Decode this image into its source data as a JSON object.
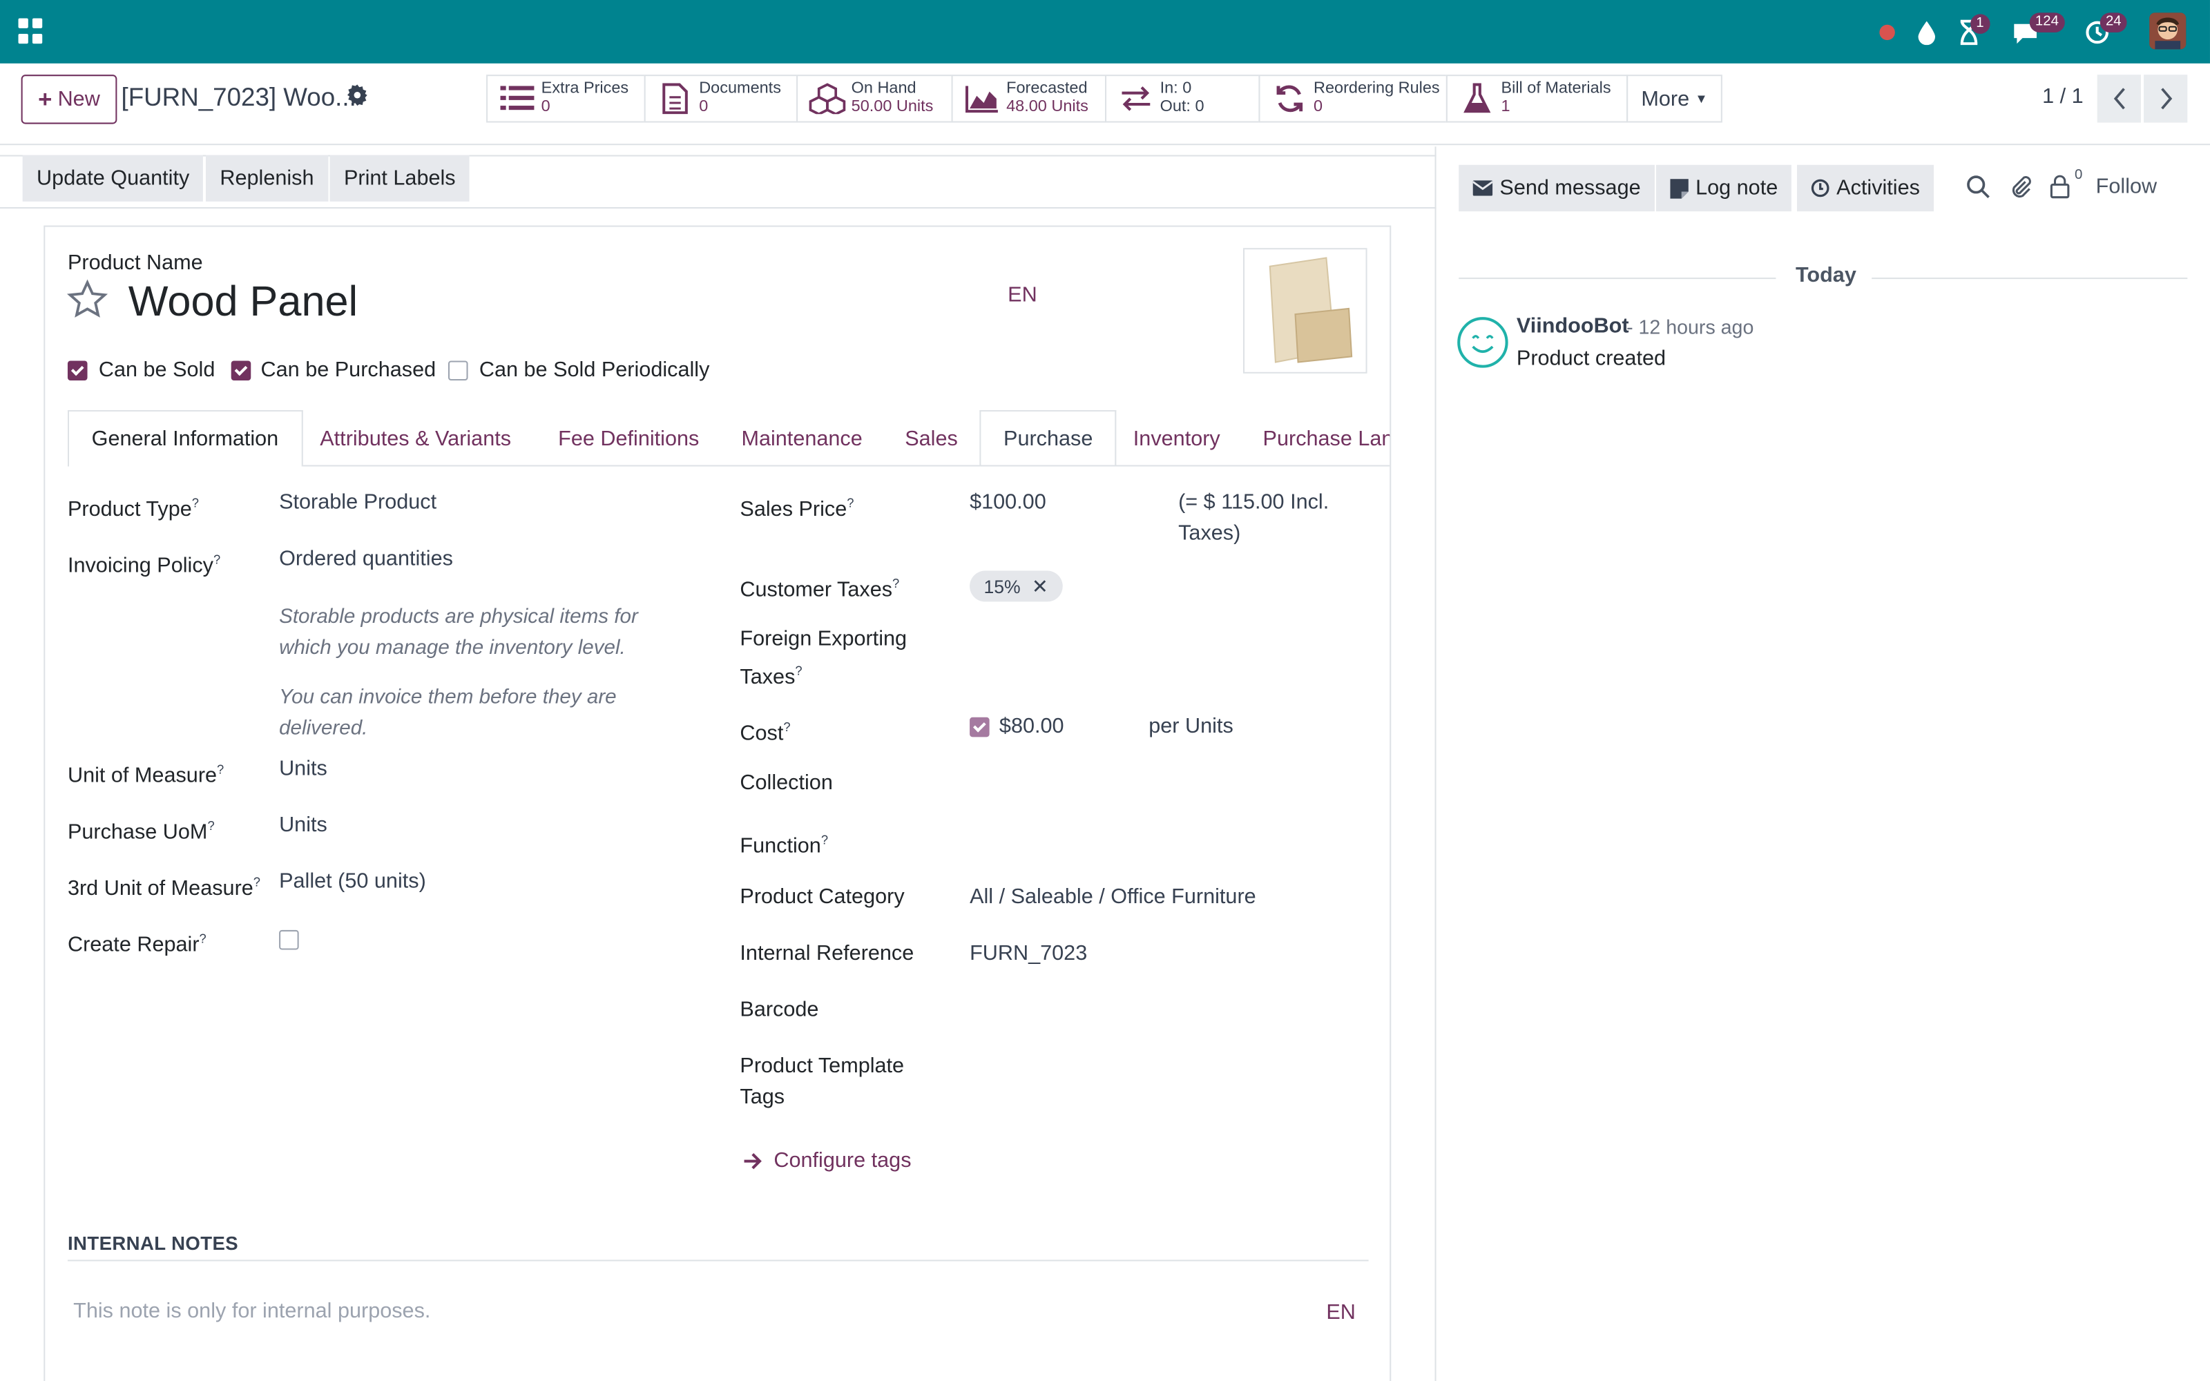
{
  "colors": {
    "navbar": "#00838f",
    "brand": "#71325f",
    "badge": "#71325f"
  },
  "navbar": {
    "badges": {
      "activities": "1",
      "messages": "124",
      "timer": "24"
    },
    "icons": [
      "apps-icon",
      "record-dot-icon",
      "drop-icon",
      "hourglass-icon",
      "chat-icon",
      "timer-icon",
      "user-avatar"
    ]
  },
  "control_panel": {
    "new_label": "New",
    "record_title": "[FURN_7023] Woo...",
    "smart_buttons": [
      {
        "icon": "list-icon",
        "label": "Extra Prices",
        "value": "0"
      },
      {
        "icon": "document-icon",
        "label": "Documents",
        "value": "0"
      },
      {
        "icon": "cubes-icon",
        "label": "On Hand",
        "value": "50.00 Units"
      },
      {
        "icon": "area-chart-icon",
        "label": "Forecasted",
        "value": "48.00 Units"
      },
      {
        "icon": "exchange-icon",
        "label": "In: 0",
        "value": "Out: 0"
      },
      {
        "icon": "refresh-icon",
        "label": "Reordering Rules",
        "value": "0"
      },
      {
        "icon": "flask-icon",
        "label": "Bill of Materials",
        "value": "1"
      }
    ],
    "more_label": "More",
    "pager": "1 / 1"
  },
  "statusbar": {
    "buttons": [
      "Update Quantity",
      "Replenish",
      "Print Labels"
    ]
  },
  "form": {
    "product_name_label": "Product Name",
    "product_name": "Wood Panel",
    "lang": "EN",
    "checkboxes": [
      {
        "label": "Can be Sold",
        "checked": true
      },
      {
        "label": "Can be Purchased",
        "checked": true
      },
      {
        "label": "Can be Sold Periodically",
        "checked": false
      }
    ],
    "tabs": [
      "General Information",
      "Attributes & Variants",
      "Fee Definitions",
      "Maintenance",
      "Sales",
      "Purchase",
      "Inventory",
      "Purchase Lan"
    ],
    "left_fields": {
      "product_type": {
        "label": "Product Type",
        "value": "Storable Product"
      },
      "invoicing_policy": {
        "label": "Invoicing Policy",
        "value": "Ordered quantities"
      },
      "help1": "Storable products are physical items for which you manage the inventory level.",
      "help2": "You can invoice them before they are delivered.",
      "uom": {
        "label": "Unit of Measure",
        "value": "Units"
      },
      "purchase_uom": {
        "label": "Purchase UoM",
        "value": "Units"
      },
      "third_uom": {
        "label": "3rd Unit of Measure",
        "value": "Pallet (50 units)"
      },
      "create_repair": {
        "label": "Create Repair",
        "checked": false
      }
    },
    "right_fields": {
      "sales_price": {
        "label": "Sales Price",
        "value": "$100.00",
        "incl": "(= $ 115.00 Incl. Taxes)"
      },
      "customer_taxes": {
        "label": "Customer Taxes",
        "tag": "15%"
      },
      "foreign_taxes": {
        "label": "Foreign Exporting Taxes"
      },
      "cost": {
        "label": "Cost",
        "value": "$80.00",
        "per": "per Units"
      },
      "collection": {
        "label": "Collection"
      },
      "function": {
        "label": "Function"
      },
      "category": {
        "label": "Product Category",
        "value": "All / Saleable / Office Furniture"
      },
      "internal_ref": {
        "label": "Internal Reference",
        "value": "FURN_7023"
      },
      "barcode": {
        "label": "Barcode"
      },
      "template_tags": {
        "label": "Product Template Tags"
      },
      "configure_tags": "Configure tags"
    },
    "notes": {
      "heading": "INTERNAL NOTES",
      "placeholder": "This note is only for internal purposes.",
      "lang": "EN"
    }
  },
  "chatter": {
    "send_message": "Send message",
    "log_note": "Log note",
    "activities": "Activities",
    "followers_count": "0",
    "follow": "Follow",
    "today": "Today",
    "messages": [
      {
        "author": "ViindooBot",
        "time": "- 12 hours ago",
        "body": "Product created"
      }
    ]
  }
}
